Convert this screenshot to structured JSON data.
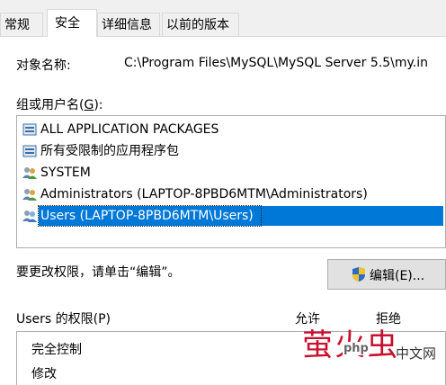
{
  "tabs": [
    {
      "label": "常规",
      "active": false
    },
    {
      "label": "安全",
      "active": true
    },
    {
      "label": "详细信息",
      "active": false
    },
    {
      "label": "以前的版本",
      "active": false
    }
  ],
  "object": {
    "label": "对象名称:",
    "value": "C:\\Program Files\\MySQL\\MySQL Server 5.5\\my.in"
  },
  "groups": {
    "label_prefix": "组或用户名(",
    "label_key": "G",
    "label_suffix": "):",
    "items": [
      {
        "label": "ALL APPLICATION PACKAGES",
        "icon": "app-package-icon",
        "selected": false
      },
      {
        "label": "所有受限制的应用程序包",
        "icon": "app-package-icon",
        "selected": false
      },
      {
        "label": "SYSTEM",
        "icon": "user-group-icon",
        "selected": false
      },
      {
        "label": "Administrators (LAPTOP-8PBD6MTM\\Administrators)",
        "icon": "user-group-icon",
        "selected": false
      },
      {
        "label": "Users (LAPTOP-8PBD6MTM\\Users)",
        "icon": "user-group-icon",
        "selected": true
      }
    ]
  },
  "change_hint": "要更改权限，请单击“编辑”。",
  "edit_button": {
    "label": "编辑(E)...",
    "icon": "uac-shield-icon"
  },
  "permissions": {
    "title": "Users 的权限(P)",
    "allow_header": "允许",
    "deny_header": "拒绝",
    "rows": [
      "完全控制",
      "修改"
    ]
  },
  "watermark": {
    "chinese": "萤火虫",
    "php": "php",
    "lang": "中文网"
  },
  "colors": {
    "selection": "#0078d7",
    "watermark_red": "#c8102e"
  }
}
